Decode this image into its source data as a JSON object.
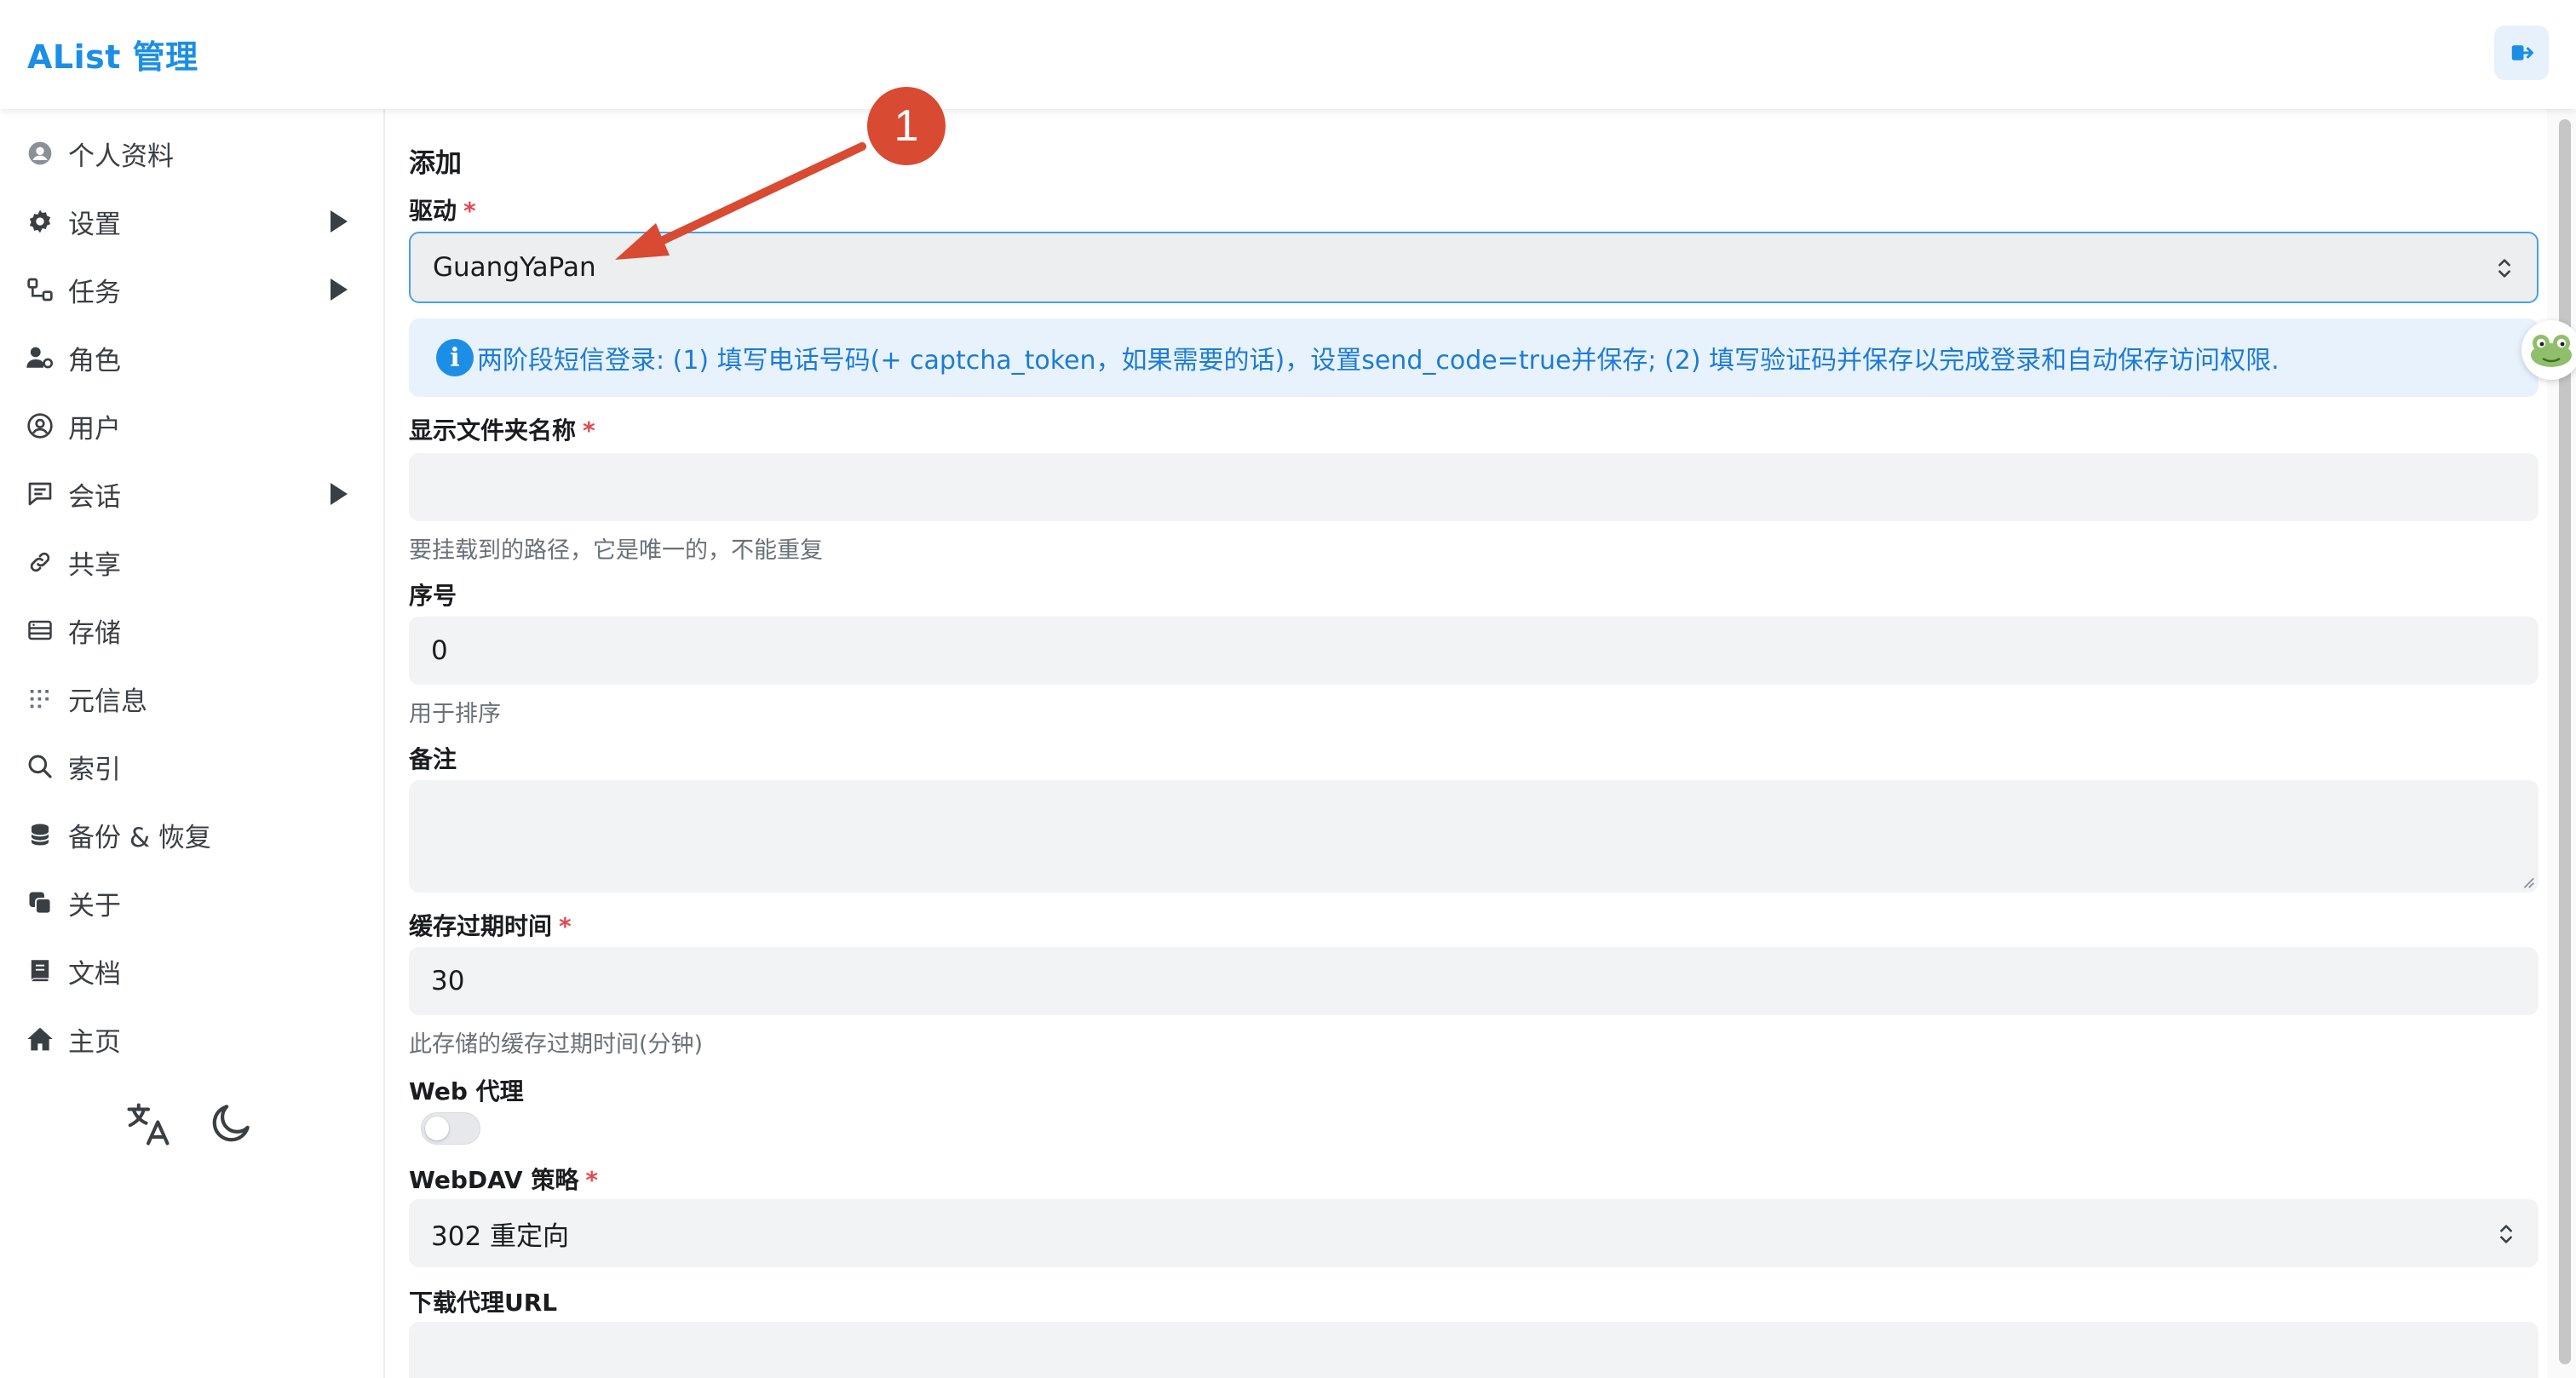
{
  "header": {
    "title": "AList 管理"
  },
  "sidebar": {
    "items": [
      {
        "label": "个人资料",
        "icon": "user-circle-icon",
        "has_arrow": false
      },
      {
        "label": "设置",
        "icon": "gear-icon",
        "has_arrow": true
      },
      {
        "label": "任务",
        "icon": "flow-icon",
        "has_arrow": true
      },
      {
        "label": "角色",
        "icon": "user-gear-icon",
        "has_arrow": false
      },
      {
        "label": "用户",
        "icon": "user-icon",
        "has_arrow": false
      },
      {
        "label": "会话",
        "icon": "chat-icon",
        "has_arrow": true
      },
      {
        "label": "共享",
        "icon": "link-icon",
        "has_arrow": false
      },
      {
        "label": "存储",
        "icon": "storage-icon",
        "has_arrow": false
      },
      {
        "label": "元信息",
        "icon": "meta-icon",
        "has_arrow": false
      },
      {
        "label": "索引",
        "icon": "search-icon",
        "has_arrow": false
      },
      {
        "label": "备份 & 恢复",
        "icon": "database-icon",
        "has_arrow": false
      },
      {
        "label": "关于",
        "icon": "copy-icon",
        "has_arrow": false
      },
      {
        "label": "文档",
        "icon": "book-icon",
        "has_arrow": false
      },
      {
        "label": "主页",
        "icon": "home-icon",
        "has_arrow": false
      }
    ]
  },
  "form": {
    "section_title": "添加",
    "required_mark": "*",
    "driver": {
      "label": "驱动",
      "value": "GuangYaPan"
    },
    "alert": {
      "icon_glyph": "i",
      "text": "两阶段短信登录: (1) 填写电话号码(+ captcha_token，如果需要的话)，设置send_code=true并保存; (2) 填写验证码并保存以完成登录和自动保存访问权限."
    },
    "mount_path": {
      "label": "显示文件夹名称",
      "value": "",
      "helper": "要挂载到的路径，它是唯一的，不能重复"
    },
    "order": {
      "label": "序号",
      "value": "0",
      "helper": "用于排序"
    },
    "remark": {
      "label": "备注",
      "value": ""
    },
    "cache_expiration": {
      "label": "缓存过期时间",
      "value": "30",
      "helper": "此存储的缓存过期时间(分钟)"
    },
    "web_proxy": {
      "label": "Web 代理",
      "enabled": false
    },
    "webdav_policy": {
      "label": "WebDAV 策略",
      "value": "302 重定向"
    },
    "down_proxy_url": {
      "label": "下载代理URL",
      "value": ""
    }
  },
  "annotation": {
    "badge": "1",
    "color": "#d94a32"
  },
  "colors": {
    "brand": "#1c8ee6",
    "alert_bg": "#e8f2fd",
    "required": "#e5484d"
  }
}
